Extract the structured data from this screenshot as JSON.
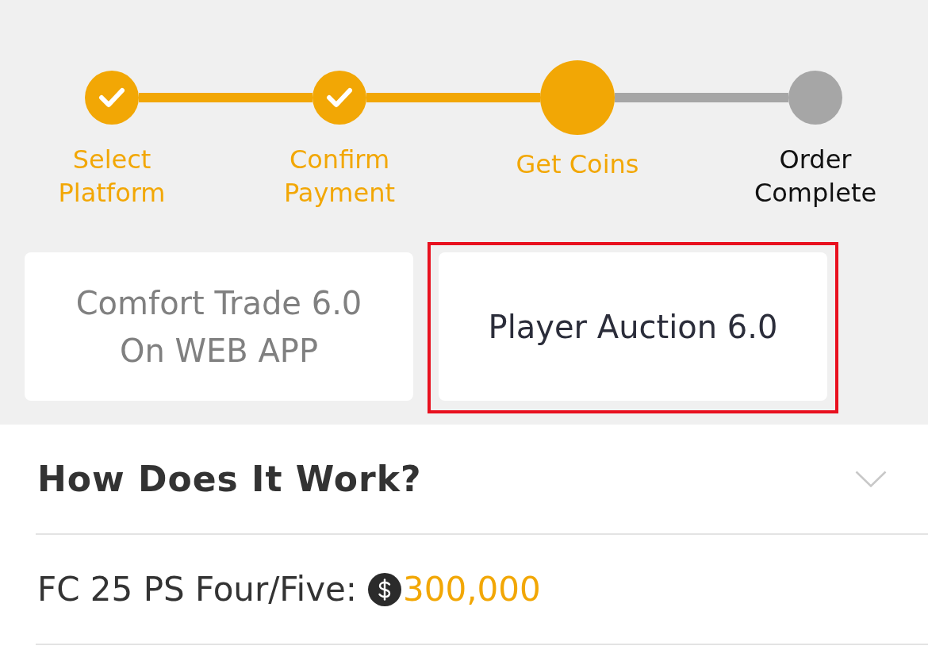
{
  "steps": [
    {
      "label": "Select Platform",
      "completed": true,
      "current": false
    },
    {
      "label": "Confirm Payment",
      "completed": true,
      "current": false
    },
    {
      "label": "Get Coins",
      "completed": false,
      "current": true
    },
    {
      "label": "Order Complete",
      "completed": false,
      "current": false
    }
  ],
  "methods": [
    {
      "label": "Comfort Trade 6.0 On WEB APP",
      "selected": false
    },
    {
      "label": "Player Auction 6.0",
      "selected": true
    }
  ],
  "accordion": {
    "title": "How Does It Work?",
    "expanded": false
  },
  "price": {
    "label": "FC 25 PS Four/Five:",
    "amount": "300,000"
  }
}
